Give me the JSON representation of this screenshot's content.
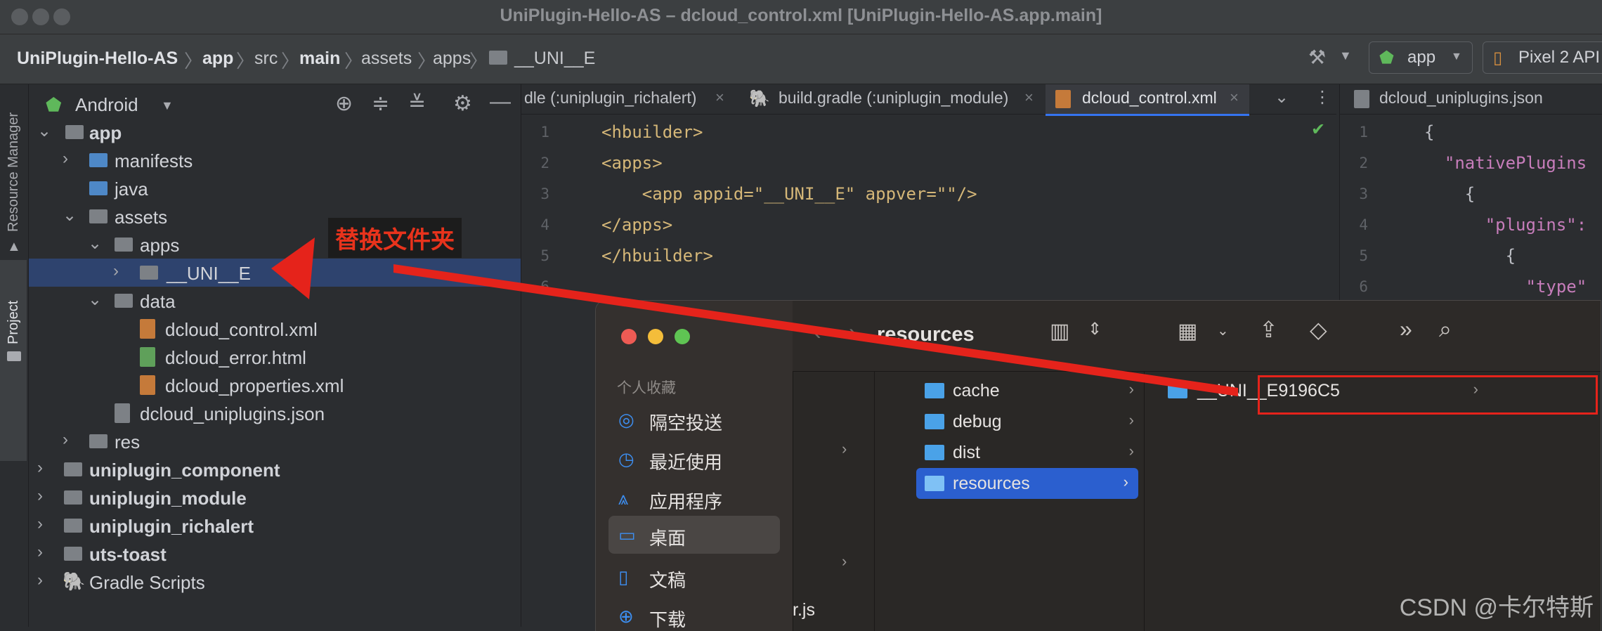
{
  "window": {
    "title": "UniPlugin-Hello-AS – dcloud_control.xml [UniPlugin-Hello-AS.app.main]"
  },
  "breadcrumb": [
    "UniPlugin-Hello-AS",
    "app",
    "src",
    "main",
    "assets",
    "apps",
    "__UNI__E"
  ],
  "toolbar": {
    "run_config": "app",
    "device": "Pixel 2 API"
  },
  "side_tools": {
    "resource_manager": "Resource Manager",
    "project": "Project"
  },
  "project_panel": {
    "view_selector": "Android",
    "tree": [
      {
        "label": "app"
      },
      {
        "label": "manifests"
      },
      {
        "label": "java"
      },
      {
        "label": "assets"
      },
      {
        "label": "apps"
      },
      {
        "label": "__UNI__E"
      },
      {
        "label": "data"
      },
      {
        "label": "dcloud_control.xml"
      },
      {
        "label": "dcloud_error.html"
      },
      {
        "label": "dcloud_properties.xml"
      },
      {
        "label": "dcloud_uniplugins.json"
      },
      {
        "label": "res"
      },
      {
        "label": "uniplugin_component"
      },
      {
        "label": "uniplugin_module"
      },
      {
        "label": "uniplugin_richalert"
      },
      {
        "label": "uts-toast"
      },
      {
        "label": "Gradle Scripts"
      }
    ]
  },
  "editor": {
    "tabs": [
      {
        "label": "dle (:uniplugin_richalert)"
      },
      {
        "label": "build.gradle (:uniplugin_module)"
      },
      {
        "label": "dcloud_control.xml"
      }
    ],
    "lines": [
      {
        "n": "1",
        "text": "<hbuilder>"
      },
      {
        "n": "2",
        "text": "<apps>"
      },
      {
        "n": "3",
        "text": "    <app appid=\"__UNI__E\" appver=\"\"/>"
      },
      {
        "n": "4",
        "text": "</apps>"
      },
      {
        "n": "5",
        "text": "</hbuilder>"
      },
      {
        "n": "6",
        "text": ""
      }
    ]
  },
  "editor2": {
    "tab": "dcloud_uniplugins.json",
    "lines": [
      {
        "n": "1",
        "text": "{"
      },
      {
        "n": "2",
        "text": "  \"nativePlugins"
      },
      {
        "n": "3",
        "text": "    {"
      },
      {
        "n": "4",
        "text": "      \"plugins\":"
      },
      {
        "n": "5",
        "text": "        {"
      },
      {
        "n": "6",
        "text": "          \"type\""
      }
    ]
  },
  "finder": {
    "title": "resources",
    "sidebar_section": "个人收藏",
    "sidebar": [
      {
        "label": "隔空投送",
        "icon": "airdrop-icon"
      },
      {
        "label": "最近使用",
        "icon": "clock-icon"
      },
      {
        "label": "应用程序",
        "icon": "applications-icon"
      },
      {
        "label": "桌面",
        "icon": "desktop-icon"
      },
      {
        "label": "文稿",
        "icon": "document-icon"
      },
      {
        "label": "下载",
        "icon": "download-icon"
      }
    ],
    "col1_fragment": "r.js",
    "col2": [
      "cache",
      "debug",
      "dist",
      "resources"
    ],
    "col3": [
      "__UNI__E9196C5"
    ]
  },
  "annotation": {
    "label": "替换文件夹",
    "color": "#e5231b"
  },
  "watermark": "CSDN @卡尔特斯"
}
